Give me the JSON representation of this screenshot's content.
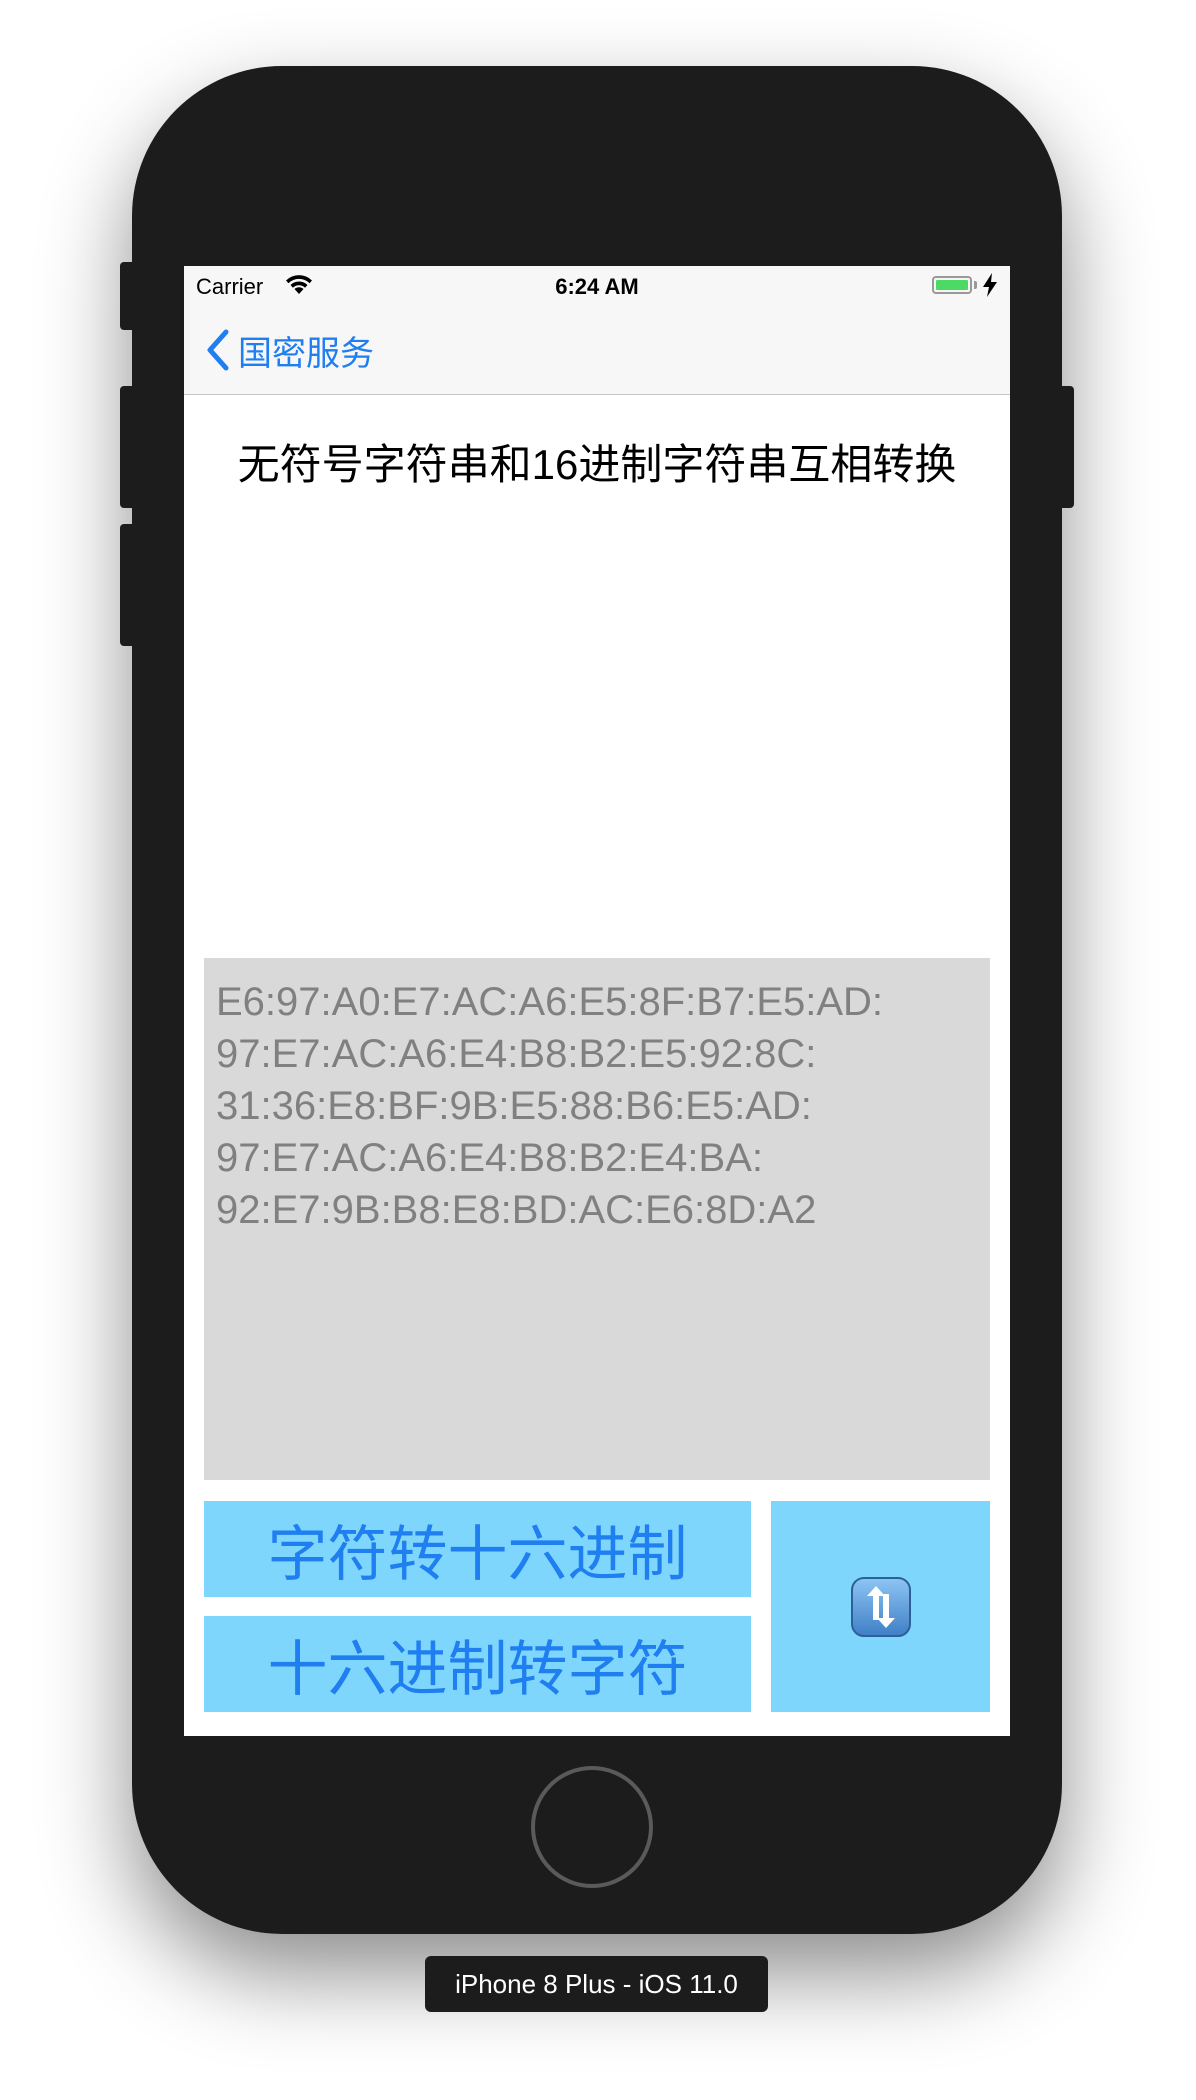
{
  "status_bar": {
    "carrier": "Carrier",
    "time": "6:24 AM",
    "battery_color": "#4cd964"
  },
  "nav": {
    "back_label": "国密服务",
    "accent_color": "#1f7ef0"
  },
  "main": {
    "title": "无符号字符串和16进制字符串互相转换",
    "hex_text": "E6:97:A0:E7:AC:A6:E5:8F:B7:E5:AD:\n97:E7:AC:A6:E4:B8:B2:E5:92:8C:\n31:36:E8:BF:9B:E5:88:B6:E5:AD:\n97:E7:AC:A6:E4:B8:B2:E4:BA:\n92:E7:9B:B8:E8:BD:AC:E6:8D:A2",
    "buttons": {
      "str_to_hex": "字符转十六进制",
      "hex_to_str": "十六进制转字符",
      "swap_icon": "swap-arrows-icon"
    },
    "button_color": "#7fd6fd"
  },
  "device": {
    "label": "iPhone 8 Plus - iOS 11.0"
  }
}
